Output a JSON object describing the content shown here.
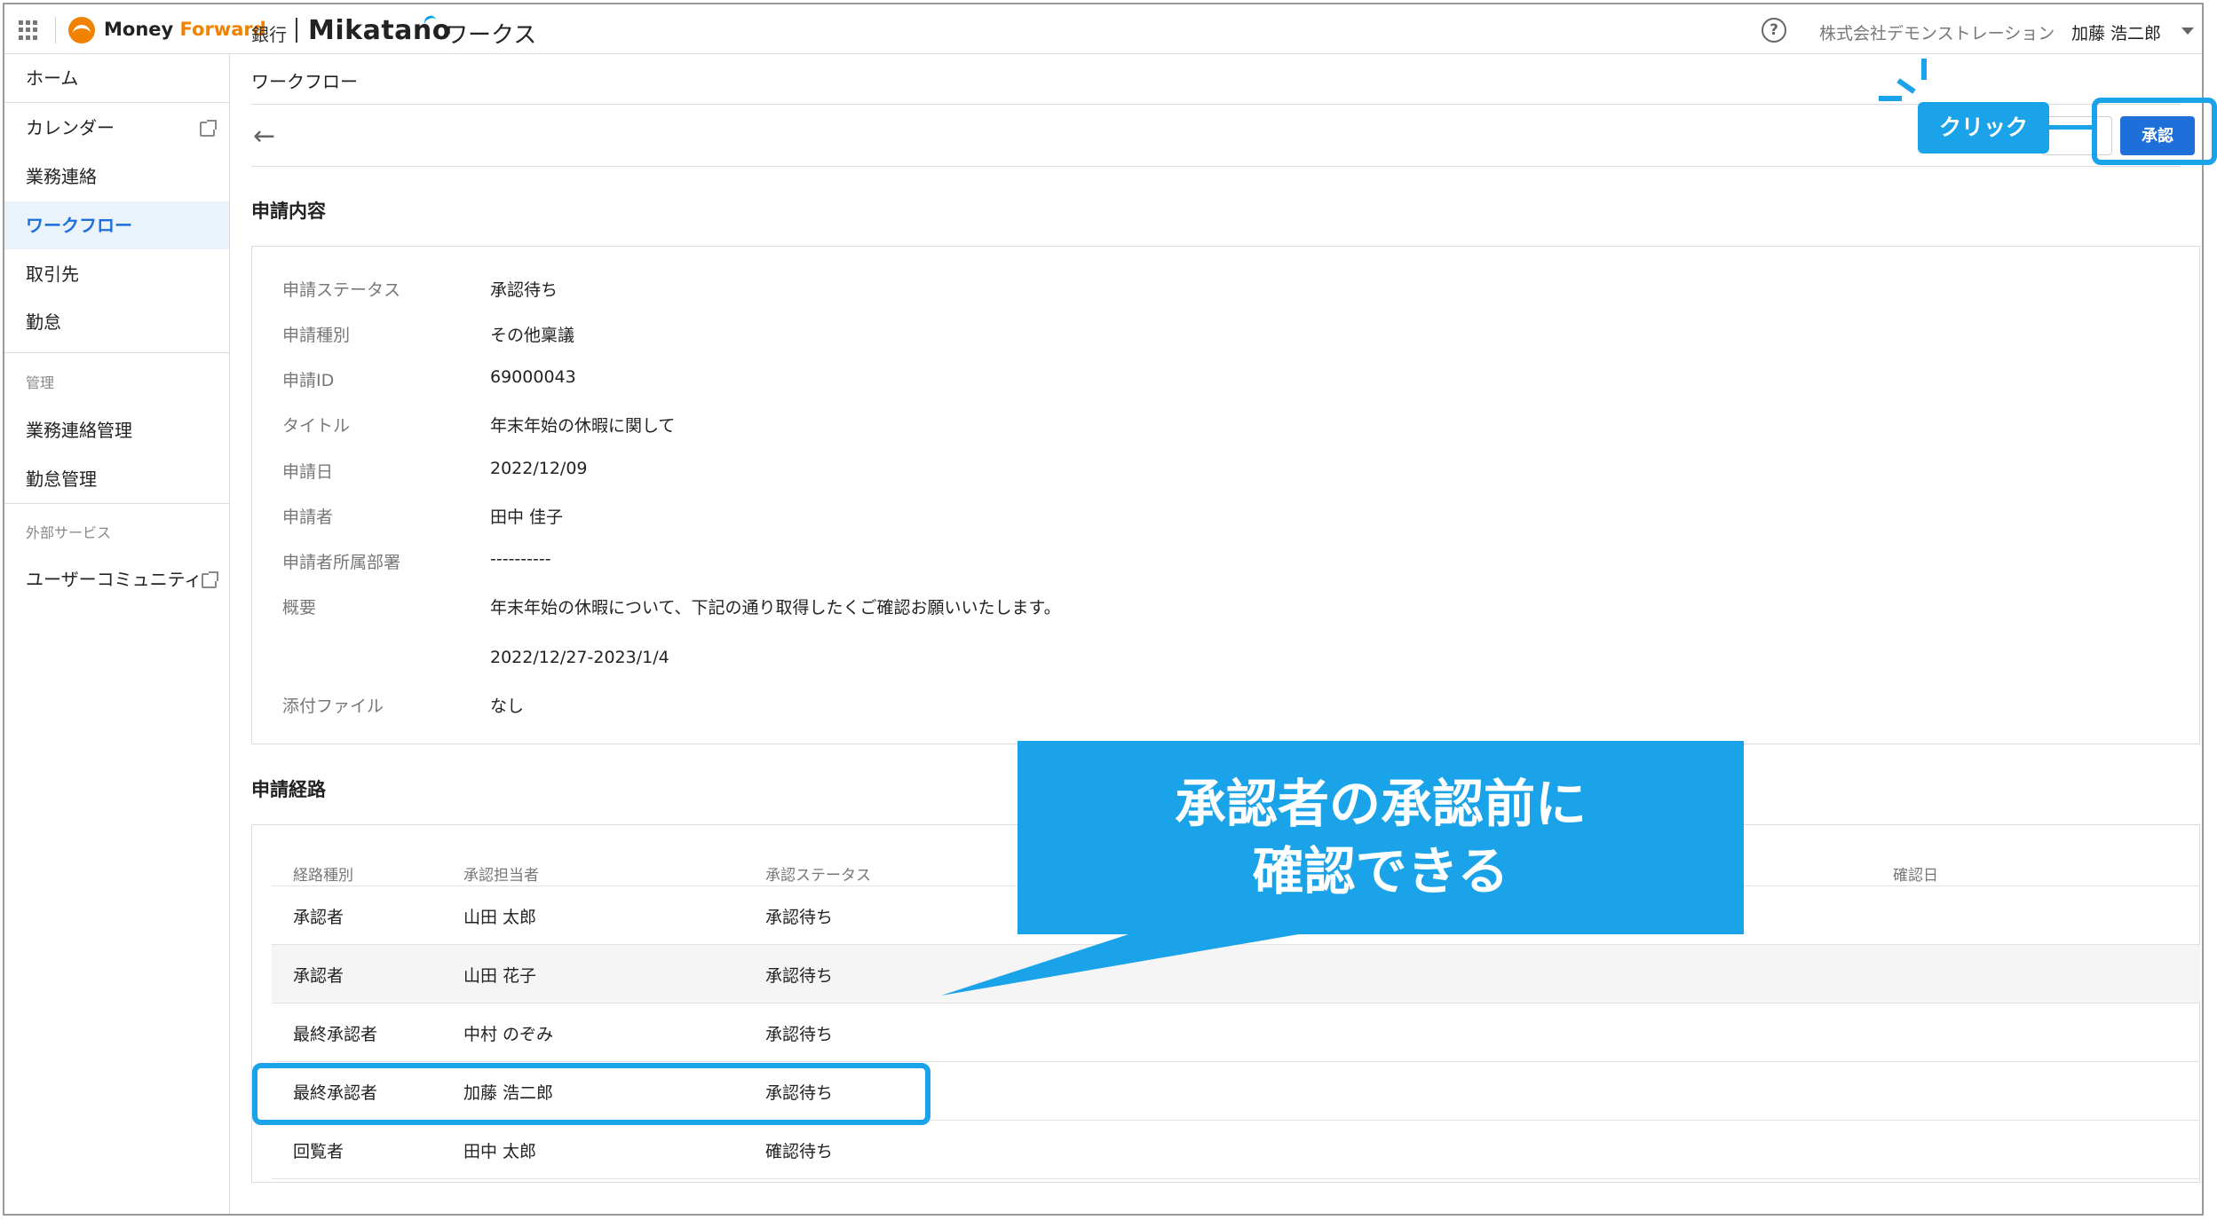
{
  "header": {
    "brand_money": "Money ",
    "brand_forward": "Forward",
    "brand_bank": "銀行",
    "brand_mikatano": "Mikatano",
    "brand_works": "ワークス",
    "company": "株式会社デモンストレーション",
    "user": "加藤 浩二郎"
  },
  "sidebar": {
    "items": [
      {
        "label": "ホーム"
      },
      {
        "label": "カレンダー"
      },
      {
        "label": "業務連絡"
      },
      {
        "label": "ワークフロー"
      },
      {
        "label": "取引先"
      },
      {
        "label": "勤怠"
      }
    ],
    "admin_section": "管理",
    "admin_items": [
      {
        "label": "業務連絡管理"
      },
      {
        "label": "勤怠管理"
      }
    ],
    "external_section": "外部サービス",
    "external_items": [
      {
        "label": "ユーザーコミュニティ"
      }
    ]
  },
  "main": {
    "page_title": "ワークフロー",
    "approve_label": "承認",
    "details_heading": "申請内容",
    "details": [
      {
        "label": "申請ステータス",
        "value": "承認待ち"
      },
      {
        "label": "申請種別",
        "value": "その他稟議"
      },
      {
        "label": "申請ID",
        "value": "69000043"
      },
      {
        "label": "タイトル",
        "value": "年末年始の休暇に関して"
      },
      {
        "label": "申請日",
        "value": "2022/12/09"
      },
      {
        "label": "申請者",
        "value": "田中 佳子"
      },
      {
        "label": "申請者所属部署",
        "value": "----------"
      },
      {
        "label": "概要",
        "value": "年末年始の休暇について、下記の通り取得したくご確認お願いいたします。"
      },
      {
        "label": "",
        "value": "2022/12/27-2023/1/4"
      },
      {
        "label": "添付ファイル",
        "value": "なし"
      }
    ],
    "route_heading": "申請経路",
    "route_columns": [
      "経路種別",
      "承認担当者",
      "承認ステータス",
      "確認日"
    ],
    "route_rows": [
      {
        "type": "承認者",
        "person": "山田 太郎",
        "status": "承認待ち"
      },
      {
        "type": "承認者",
        "person": "山田 花子",
        "status": "承認待ち"
      },
      {
        "type": "最終承認者",
        "person": "中村 のぞみ",
        "status": "承認待ち"
      },
      {
        "type": "最終承認者",
        "person": "加藤 浩二郎",
        "status": "承認待ち"
      },
      {
        "type": "回覧者",
        "person": "田中 太郎",
        "status": "確認待ち"
      }
    ]
  },
  "annotations": {
    "click_label": "クリック",
    "callout_line1": "承認者の承認前に",
    "callout_line2": "確認できる",
    "accent_color": "#1aa3e8"
  }
}
